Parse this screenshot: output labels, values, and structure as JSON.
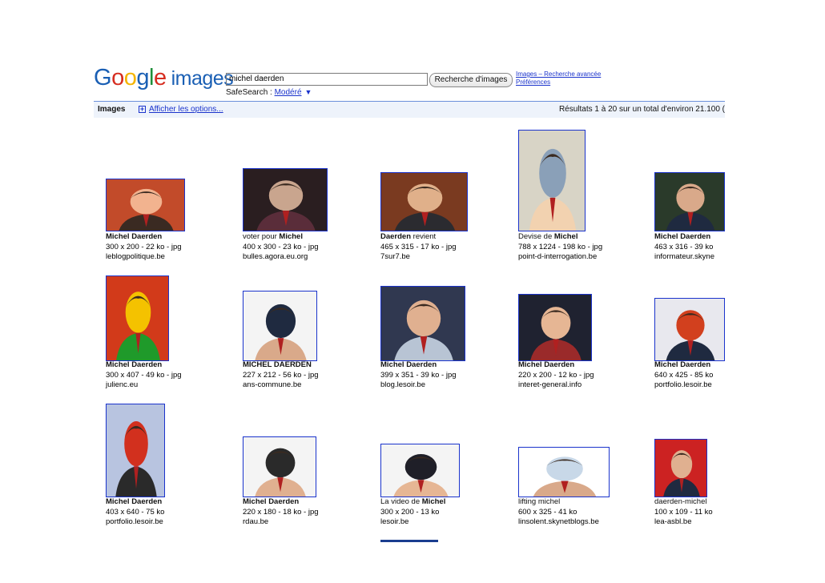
{
  "header": {
    "logo_google": "Google",
    "logo_images": "images",
    "search_value": "michel daerden",
    "search_button": "Recherche d'images",
    "advanced_link": "Images – Recherche avancée",
    "prefs_link": "Préférences",
    "safesearch_label": "SafeSearch : ",
    "safesearch_mode": "Modéré",
    "safesearch_arrow": "▼"
  },
  "bar": {
    "tab": "Images",
    "options_link": "Afficher les options...",
    "results": "Résultats 1 à 20 sur un total d'environ 21.100 ("
  },
  "results": [
    {
      "pre": "",
      "bold": "Michel Daerden",
      "post": "",
      "meta": "300 x 200 - 22 ko - jpg",
      "domain": "leblogpolitique.be"
    },
    {
      "pre": "voter pour ",
      "bold": "Michel",
      "post": "",
      "meta": "400 x 300 - 23 ko - jpg",
      "domain": "bulles.agora.eu.org"
    },
    {
      "pre": "",
      "bold": "Daerden",
      "post": " revient",
      "meta": "465 x 315 - 17 ko - jpg",
      "domain": "7sur7.be"
    },
    {
      "pre": "Devise de ",
      "bold": "Michel",
      "post": "",
      "meta": "788 x 1224 - 198 ko - jpg",
      "domain": "point-d-interrogation.be"
    },
    {
      "pre": "",
      "bold": "Michel Daerden",
      "post": "",
      "meta": "463 x 316 - 39 ko",
      "domain": "informateur.skyne"
    },
    {
      "pre": "",
      "bold": "Michel Daerden",
      "post": "",
      "meta": "300 x 407 - 49 ko - jpg",
      "domain": "julienc.eu"
    },
    {
      "pre": "",
      "bold": "MICHEL DAERDEN",
      "post": "",
      "meta": "227 x 212 - 56 ko - jpg",
      "domain": "ans-commune.be"
    },
    {
      "pre": "",
      "bold": "Michel Daerden",
      "post": "",
      "meta": "399 x 351 - 39 ko - jpg",
      "domain": "blog.lesoir.be"
    },
    {
      "pre": "",
      "bold": "Michel Daerden",
      "post": "",
      "meta": "220 x 200 - 12 ko - jpg",
      "domain": "interet-general.info"
    },
    {
      "pre": "",
      "bold": "Michel Daerden",
      "post": "",
      "meta": "640 x 425 - 85 ko",
      "domain": "portfolio.lesoir.be"
    },
    {
      "pre": "",
      "bold": "Michel Daerden",
      "post": "",
      "meta": "403 x 640 - 75 ko",
      "domain": "portfolio.lesoir.be"
    },
    {
      "pre": "",
      "bold": "Michel Daerden",
      "post": "",
      "meta": "220 x 180 - 18 ko - jpg",
      "domain": "rdau.be"
    },
    {
      "pre": "La video de ",
      "bold": "Michel",
      "post": "",
      "meta": "300 x 200 - 13 ko",
      "domain": "lesoir.be"
    },
    {
      "pre": "",
      "bold": "",
      "post": "lifting michel",
      "meta": "600 x 325 - 41 ko",
      "domain": "linsolent.skynetblogs.be"
    },
    {
      "pre": "",
      "bold": "",
      "post": "daerden-michel",
      "meta": "100 x 109 - 11 ko",
      "domain": "lea-asbl.be"
    }
  ],
  "colors": {
    "link": "#1a33cc",
    "domain": "#118811",
    "bar_bg": "#eef3fb",
    "logo_blue": "#1a5fb4",
    "logo_red": "#d62d20",
    "logo_yellow": "#f4b400",
    "logo_green": "#1e8f3a"
  }
}
